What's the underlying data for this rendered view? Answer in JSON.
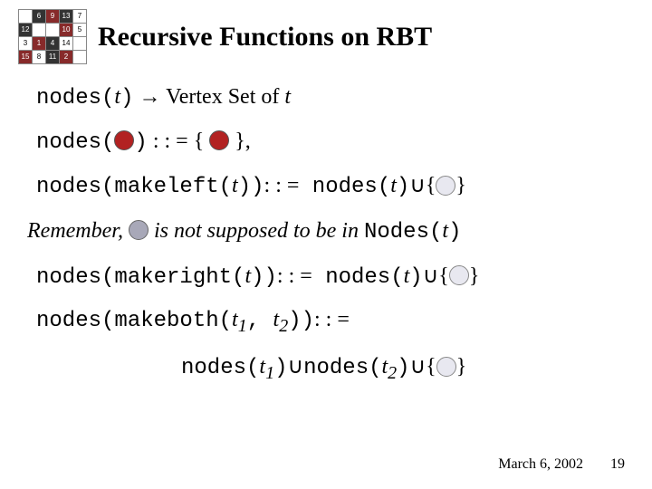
{
  "sudoku": [
    [
      "",
      "6",
      "9",
      "13",
      "7"
    ],
    [
      "12",
      "",
      "",
      "10",
      "5"
    ],
    [
      "3",
      "1",
      "4",
      "14",
      ""
    ],
    [
      "15",
      "8",
      "11",
      "2",
      ""
    ]
  ],
  "title": "Recursive Functions on RBT",
  "lines": {
    "l1_a": "nodes(",
    "l1_b": ")",
    "l1_c": " → Vertex Set of ",
    "l1_d": "t",
    "l2_a": "nodes(",
    "l2_b": ")",
    "l2_c": " : : = { ",
    "l2_d": " },",
    "l3_a": "nodes(makeleft(",
    "l3_b": "))",
    "l3_c": ": : =",
    "l3_d": " nodes(",
    "l3_e": ")",
    "l3_f": "{",
    "l3_g": "}",
    "rem_a": "Remember,",
    "rem_b": " is not supposed to be in ",
    "rem_c": "Nodes(",
    "rem_d": ")",
    "l5_a": "nodes(makeright(",
    "l5_b": "))",
    "l5_c": ": : =",
    "l5_d": " nodes(",
    "l5_e": ")",
    "l5_f": "{",
    "l5_g": "}",
    "l6_a": "nodes(makeboth(",
    "l6_b": ", ",
    "l6_c": "))",
    "l6_d": ": : =",
    "l7_a": "nodes(",
    "l7_b": ")",
    "l7_c": "nodes(",
    "l7_d": ")",
    "l7_e": "{",
    "l7_f": "}",
    "t": "t",
    "t1": "t",
    "t1sub": "1",
    "t2": "t",
    "t2sub": "2",
    "cup": "∪"
  },
  "footer": {
    "date": "March 6, 2002",
    "page": "19"
  }
}
